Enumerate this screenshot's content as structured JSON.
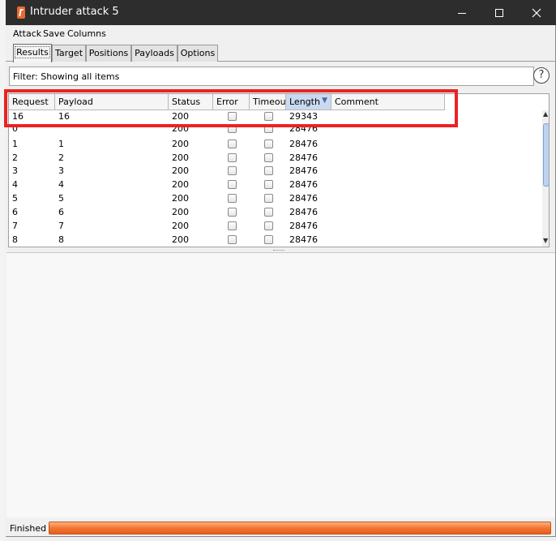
{
  "window": {
    "title": "Intruder attack 5"
  },
  "menu": [
    "Attack",
    "Save",
    "Columns"
  ],
  "tabs": [
    "Results",
    "Target",
    "Positions",
    "Payloads",
    "Options"
  ],
  "filter": {
    "text": "Filter: Showing all items"
  },
  "help": {
    "label": "?"
  },
  "table": {
    "columns": [
      "Request",
      "Payload",
      "Status",
      "Error",
      "Timeout",
      "Length",
      "Comment"
    ],
    "rows": [
      {
        "request": "16",
        "payload": "16",
        "status": "200",
        "length": "29343"
      },
      {
        "request": "0",
        "payload": "",
        "status": "200",
        "length": "28476"
      },
      {
        "request": "1",
        "payload": "1",
        "status": "200",
        "length": "28476"
      },
      {
        "request": "2",
        "payload": "2",
        "status": "200",
        "length": "28476"
      },
      {
        "request": "3",
        "payload": "3",
        "status": "200",
        "length": "28476"
      },
      {
        "request": "4",
        "payload": "4",
        "status": "200",
        "length": "28476"
      },
      {
        "request": "5",
        "payload": "5",
        "status": "200",
        "length": "28476"
      },
      {
        "request": "6",
        "payload": "6",
        "status": "200",
        "length": "28476"
      },
      {
        "request": "7",
        "payload": "7",
        "status": "200",
        "length": "28476"
      },
      {
        "request": "8",
        "payload": "8",
        "status": "200",
        "length": "28476"
      }
    ]
  },
  "status": {
    "label": "Finished",
    "progress": 1.0
  },
  "colors": {
    "titlebar": "#2d2d2d",
    "highlight": "#ea2323",
    "progress": "#f2712d",
    "sorted_header": "#c9daf0"
  },
  "icons": [
    "burp-app-icon",
    "minimize-icon",
    "maximize-icon",
    "close-icon",
    "help-icon",
    "sort-desc-icon",
    "scroll-up-icon",
    "scroll-down-icon"
  ]
}
